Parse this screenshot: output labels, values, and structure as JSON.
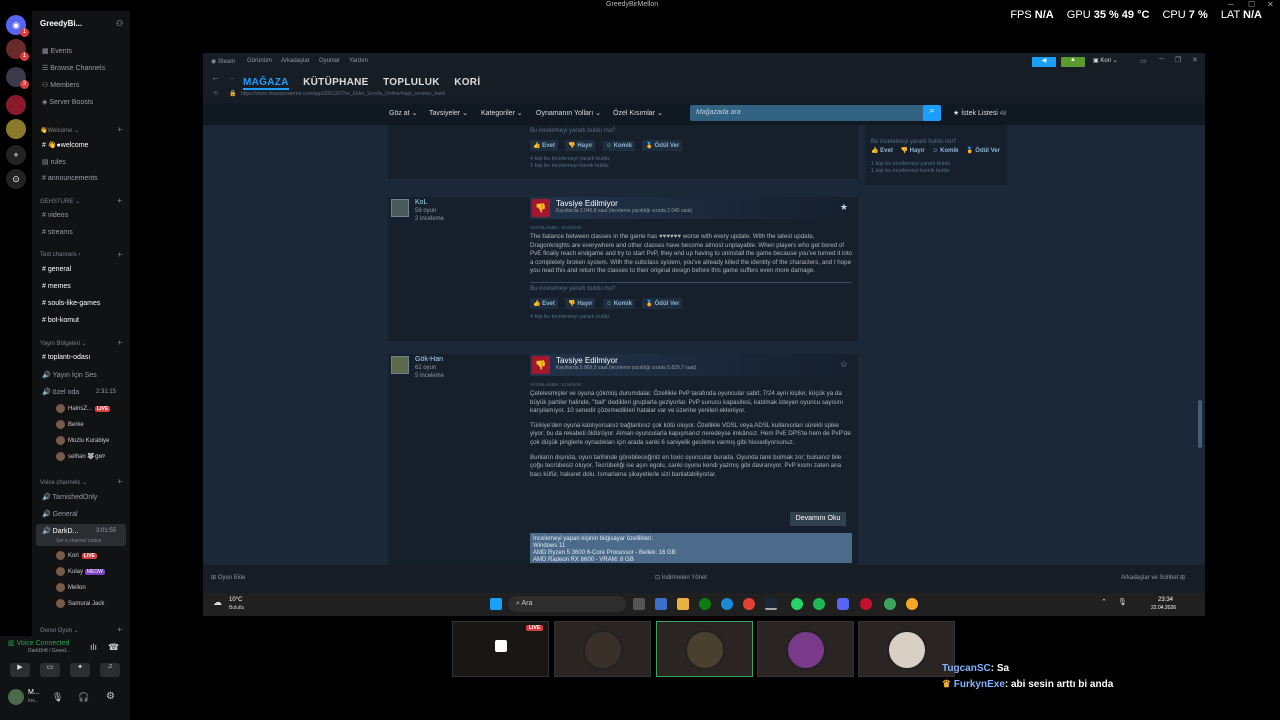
{
  "window_title": "GreedyBirMellon",
  "perf": {
    "fps_label": "FPS",
    "fps": "N/A",
    "gpu_label": "GPU",
    "gpu": "35 %",
    "gpu_temp": "49 °C",
    "cpu_label": "CPU",
    "cpu": "7 %",
    "lat_label": "LAT",
    "lat": "N/A"
  },
  "discord": {
    "guild": "GreedyBi...",
    "top": [
      "Events",
      "Browse Channels",
      "Members",
      "Server Boosts"
    ],
    "cat_welcome": "Welcome",
    "welcome_channels": [
      "welcome",
      "rules",
      "announcements"
    ],
    "cat_gehsture": "GEHSTURE",
    "gehsture_channels": [
      "videos",
      "streams"
    ],
    "cat_text": "Text channels",
    "text_channels": [
      "general",
      "memes",
      "souls-like-games",
      "bot-komut"
    ],
    "cat_broadcast": "Yayın Bölgeleri",
    "broadcast_channels": [
      "toplantı-odası",
      "Yayın İçin Ses"
    ],
    "ozel": {
      "name": "özel oda",
      "time": "2:31:15"
    },
    "ozel_users": [
      {
        "name": "HainsZ...",
        "live": "LIVE"
      },
      {
        "name": "Berke"
      },
      {
        "name": "Muzlu Kurabiye"
      },
      {
        "name": "selhan",
        "tag": "🐺ցѳ୨"
      }
    ],
    "cat_voice": "Voice channels",
    "voice_channels": [
      "TarnishedOnly",
      "General"
    ],
    "darkd": {
      "name": "DarkD...",
      "time": "3:01:55",
      "status": "Set a channel status"
    },
    "darkd_users": [
      {
        "name": "Kori",
        "live": "LIVE"
      },
      {
        "name": "Kulay",
        "tag": "MEOW"
      },
      {
        "name": "Mellon"
      },
      {
        "name": "Samurai Jack"
      }
    ],
    "cat_general": "Genel Oyun",
    "voice_connected": "Voice Connected",
    "voice_loc": "DarkDrift / Greed...",
    "me_name": "M...",
    "me_status": "Inv..."
  },
  "steam": {
    "menu": [
      "Steam",
      "Görünüm",
      "Arkadaşlar",
      "Oyunlar",
      "Yardım"
    ],
    "nav": [
      "MAĞAZA",
      "KÜTÜPHANE",
      "TOPLULUK",
      "KORİ"
    ],
    "user": "Kori",
    "url": "https://store.steampowered.com/app/306130/The_Elder_Scrolls_Online/#app_reviews_hash",
    "store_menu": [
      "Göz at",
      "Tavsiyeler",
      "Kategoriler",
      "Oynamanın Yolları",
      "Özel Kısımlar"
    ],
    "search_placeholder": "Mağazada ara",
    "wishlist": "İstek Listesi",
    "wishlist_count": "48",
    "helpful_q": "Bu incelemeyi yararlı buldu mu?",
    "vote": {
      "yes": "Evet",
      "no": "Hayır",
      "funny": "Komik",
      "award": "Ödül Ver"
    },
    "top_counts": [
      "4 kişi bu incelemeyi yararlı buldu",
      "2 kişi bu incelemeyi komik buldu"
    ],
    "right_counts": [
      "1 kişi bu incelemeyi yararlı buldu",
      "1 kişi bu incelemeyi komik buldu"
    ],
    "r1": {
      "user": "KoL",
      "games": "58 oyun",
      "reviews": "2 inceleme",
      "verdict": "Tavsiye Edilmiyor",
      "hours": "Kayıtlarda 2.045,8 saat (inceleme yazıldığı sırada 2.045 saat)",
      "date": "YAYINLANMA: 15 NİSAN",
      "text": "The balance between classes in the game has ♥♥♥♥♥♥ worse with every update. With the latest update, Dragonknights are everywhere and other classes have become almost unplayable. When players who get bored of PvE finally reach endgame and try to start PvP, they end up having to uninstall the game because you've turned it into a completely broken system. With the subclass system, you've already killed the identity of the characters, and I hope you read this and return the classes to their original design before this game suffers even more damage.",
      "count": "4 kişi bu incelemeyi yararlı buldu"
    },
    "r2": {
      "user": "Gök-Han",
      "games": "62 oyun",
      "reviews": "5 inceleme",
      "verdict": "Tavsiye Edilmiyor",
      "hours": "Kayıtlarda 5.869,9 saat (inceleme yazıldığı sırada 5.829,7 saat)",
      "date": "YAYINLANMA: 12 NİSAN",
      "p1": "Çetelesmişler ve oyuna çökmüş durumdalar. Özellikle PvP tarafında oyuncular sabit; 7/24 aynı kişiler, küçük ya da büyük partiler halinde, \"ball\" dedikleri gruplarla geziyorlar. PvP sunucu kapasitesi, katılmak isteyen oyuncu sayısını karşılamıyor. 10 senedir çözemedikleri hatalar var ve üzerine yenileri ekleniyor.",
      "p2": "Türkiye'den oyuna katılıyorsanız bağlantınız çok kötü oluyor. Özellikle VDSL veya ADSL kullanıcıları sürekli spike yiyor; bu da rekabeti öldürüyor. Alman oyuncularla kapışmanız neredeyse imkânsız. Hem PvE DPS'te hem de PvP'de çok düşük pinglerle oynadıkları için arada sanki 6 saniyelik gecikme varmış gibi hissediyorsunuz.",
      "p3": "Bunların dışında, oyun tarihinde görebileceğiniz en toxic oyuncular burada. Oyunda tank bulmak zor; bulsanız bile çoğu tecrübesiz oluyor. Tecrübeliği ise aşırı egolu, sanki oyunu kendi yazmış gibi davranıyor. PvP kısmı zaten ana bacı küfür, hakaret dolu. Ismarlama şikayetlerle sizi banlatabiliyorlar.",
      "readmore": "Devamını Oku",
      "specs_title": "İncelemeyi yapan kişinin bilgisayar özellikleri:",
      "specs": [
        "Windows 11",
        "AMD Ryzen 5 3600 6-Core Processor - Bellek: 16 GB",
        "AMD Radeon RX 6600 - VRAM: 8 GB"
      ]
    },
    "footer": {
      "add_game": "Oyun Ekle",
      "downloads": "İndirmeleri Yönet",
      "friends": "Arkadaşlar ve Sohbet"
    },
    "taskbar": {
      "temp": "10°C",
      "weather": "Bulutlu",
      "search": "Ara",
      "time": "23:34",
      "date": "22.04.2026"
    }
  },
  "thumb_live": "LIVE",
  "chat": [
    {
      "user": "TugcanSC",
      "msg": ": Sa"
    },
    {
      "user": "FurkynExe",
      "msg": ": abi sesin arttı bi anda"
    }
  ]
}
